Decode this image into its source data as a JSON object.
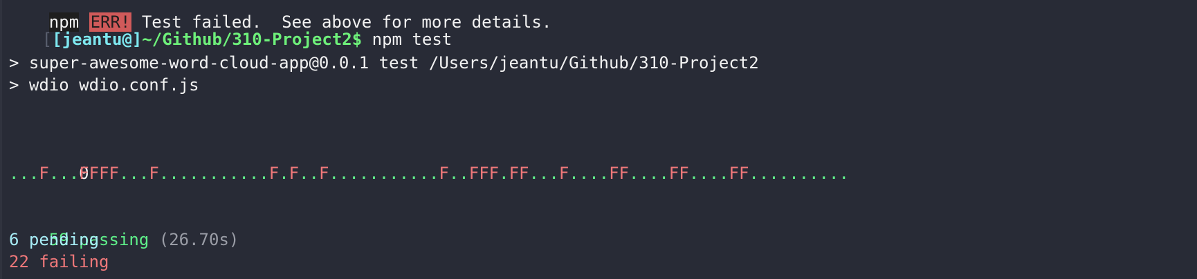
{
  "colors": {
    "background": "#282b36",
    "pass": "#5ff08a",
    "fail": "#f0787a",
    "pending": "#a8eef7",
    "prompt_user": "#7ee8f0",
    "prompt_path": "#6ef07a"
  },
  "terminal": {
    "top_line": {
      "npm": "npm",
      "err": "ERR!",
      "message": " Test failed.  See above for more details."
    },
    "prompt": {
      "open_bracket": "[",
      "user": "[jeantu@]",
      "path": "~/Github/310-Project2$",
      "command": " npm test"
    },
    "script_lines": [
      "> super-awesome-word-cloud-app@0.0.1 test /Users/jeantu/Github/310-Project2",
      "> wdio wdio.conf.js"
    ],
    "progress_line_1": {
      "dots": "...",
      "count": "0"
    },
    "progress_line_2_segments": [
      {
        "text": "...",
        "status": "pass"
      },
      {
        "text": "F",
        "status": "fail"
      },
      {
        "text": "...",
        "status": "pass"
      },
      {
        "text": "FFFF",
        "status": "fail"
      },
      {
        "text": "...",
        "status": "pass"
      },
      {
        "text": "F",
        "status": "fail"
      },
      {
        "text": "...........",
        "status": "pass"
      },
      {
        "text": "F",
        "status": "fail"
      },
      {
        "text": ".",
        "status": "pass"
      },
      {
        "text": "F",
        "status": "fail"
      },
      {
        "text": "..",
        "status": "pass"
      },
      {
        "text": "F",
        "status": "fail"
      },
      {
        "text": "...........",
        "status": "pass"
      },
      {
        "text": "F",
        "status": "fail"
      },
      {
        "text": "..",
        "status": "pass"
      },
      {
        "text": "FFF",
        "status": "fail"
      },
      {
        "text": ".",
        "status": "pass"
      },
      {
        "text": "FF",
        "status": "fail"
      },
      {
        "text": "...",
        "status": "pass"
      },
      {
        "text": "F",
        "status": "fail"
      },
      {
        "text": "....",
        "status": "pass"
      },
      {
        "text": "FF",
        "status": "fail"
      },
      {
        "text": "....",
        "status": "pass"
      },
      {
        "text": "FF",
        "status": "fail"
      },
      {
        "text": "....",
        "status": "pass"
      },
      {
        "text": "FF",
        "status": "fail"
      },
      {
        "text": "..........",
        "status": "pass"
      }
    ],
    "summary": {
      "passing": "59 passing",
      "duration": " (26.70s)",
      "pending": "6 pending",
      "failing": "22 failing"
    }
  }
}
